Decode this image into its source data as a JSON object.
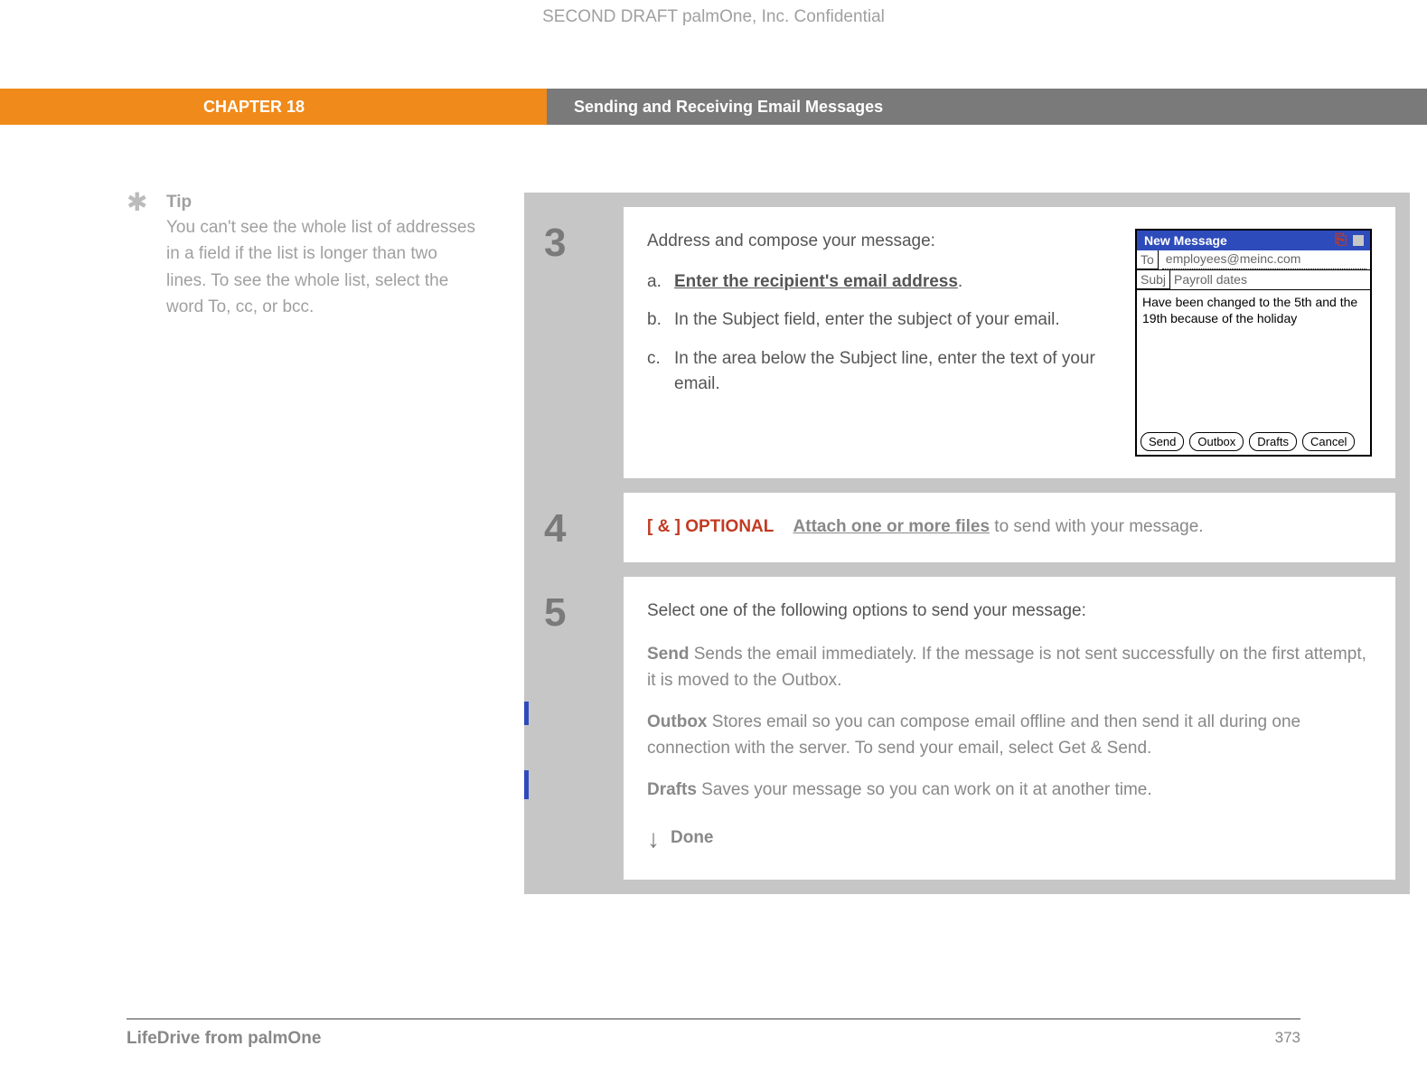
{
  "confidential": "SECOND DRAFT palmOne, Inc.  Confidential",
  "header": {
    "chapter": "CHAPTER 18",
    "title": "Sending and Receiving Email Messages"
  },
  "tip": {
    "heading": "Tip",
    "body": "You can't see the whole list of addresses in a field if the list is longer than two lines. To see the whole list, select the word To, cc, or bcc."
  },
  "step3": {
    "number": "3",
    "intro": "Address and compose your message:",
    "items": [
      {
        "label": "a.",
        "link": "Enter the recipient's email address",
        "suffix": "."
      },
      {
        "label": "b.",
        "text": "In the Subject field, enter the subject of your email."
      },
      {
        "label": "c.",
        "text": "In the area below the Subject line, enter the text of your email."
      }
    ],
    "palm": {
      "title": "New Message",
      "to_label": "To",
      "to_value": "employees@meinc.com",
      "subj_label": "Subj",
      "subj_value": "Payroll dates",
      "body": "Have been changed to the 5th and the 19th because of the holiday",
      "buttons": [
        "Send",
        "Outbox",
        "Drafts",
        "Cancel"
      ]
    }
  },
  "step4": {
    "number": "4",
    "prefix": "[ & ]",
    "optional": "OPTIONAL",
    "link": "Attach one or more files",
    "rest": " to send with your message."
  },
  "step5": {
    "number": "5",
    "intro": "Select one of the following options to send your message:",
    "options": [
      {
        "name": "Send",
        "desc": "   Sends the email immediately. If the message is not sent successfully on the first attempt, it is moved to the Outbox."
      },
      {
        "name": "Outbox",
        "desc": "   Stores email so you can compose email offline and then send it all during one connection with the server. To send your email, select Get & Send."
      },
      {
        "name": "Drafts",
        "desc": "   Saves your message so you can work on it at another time."
      }
    ],
    "done": "Done"
  },
  "footer": {
    "left": "LifeDrive from palmOne",
    "right": "373"
  }
}
